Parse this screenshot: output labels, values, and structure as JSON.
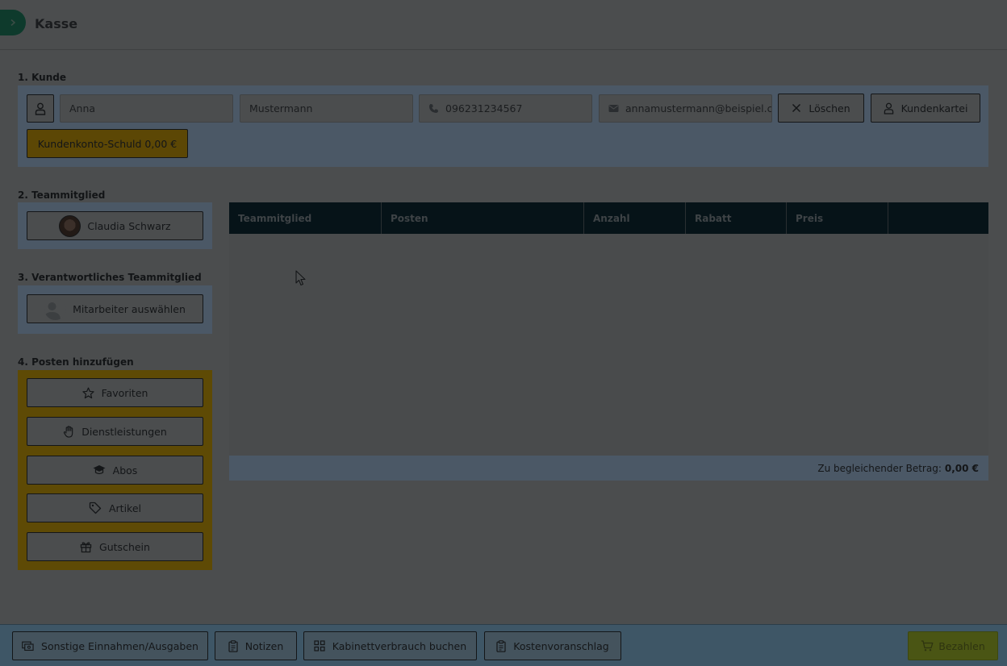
{
  "header": {
    "title": "Kasse"
  },
  "sections": {
    "customer": "1. Kunde",
    "team_member": "2. Teammitglied",
    "responsible": "3. Verantwortliches Teammitglied",
    "add_items": "4. Posten hinzufügen"
  },
  "customer": {
    "first_name": "Anna",
    "last_name": "Mustermann",
    "phone": "096231234567",
    "email": "annamustermann@beispiel.c",
    "clear_label": "Löschen",
    "card_label": "Kundenkartei",
    "debt_label": "Kundenkonto-Schuld 0,00 €"
  },
  "team_member": {
    "name": "Claudia Schwarz"
  },
  "responsible": {
    "placeholder": "Mitarbeiter auswählen"
  },
  "add_items": [
    {
      "label": "Favoriten",
      "icon": "star-icon"
    },
    {
      "label": "Dienstleistungen",
      "icon": "hand-icon"
    },
    {
      "label": "Abos",
      "icon": "graduation-cap-icon"
    },
    {
      "label": "Artikel",
      "icon": "tag-icon"
    },
    {
      "label": "Gutschein",
      "icon": "gift-icon"
    }
  ],
  "table": {
    "columns": [
      "Teammitglied",
      "Posten",
      "Anzahl",
      "Rabatt",
      "Preis",
      ""
    ],
    "rows": []
  },
  "total": {
    "label": "Zu begleichender Betrag:",
    "amount": "0,00 €"
  },
  "footer": {
    "other": "Sonstige Einnahmen/Ausgaben",
    "notes": "Notizen",
    "cabinet": "Kabinettverbrauch buchen",
    "estimate": "Kostenvoranschlag",
    "pay": "Bezahlen"
  },
  "colors": {
    "accent_dark": "#0e3a2c",
    "panel_blue": "#4b5866",
    "panel_yellow": "#5e4a05",
    "table_header": "#061318",
    "overlay_bg": "#4b4d4e"
  }
}
